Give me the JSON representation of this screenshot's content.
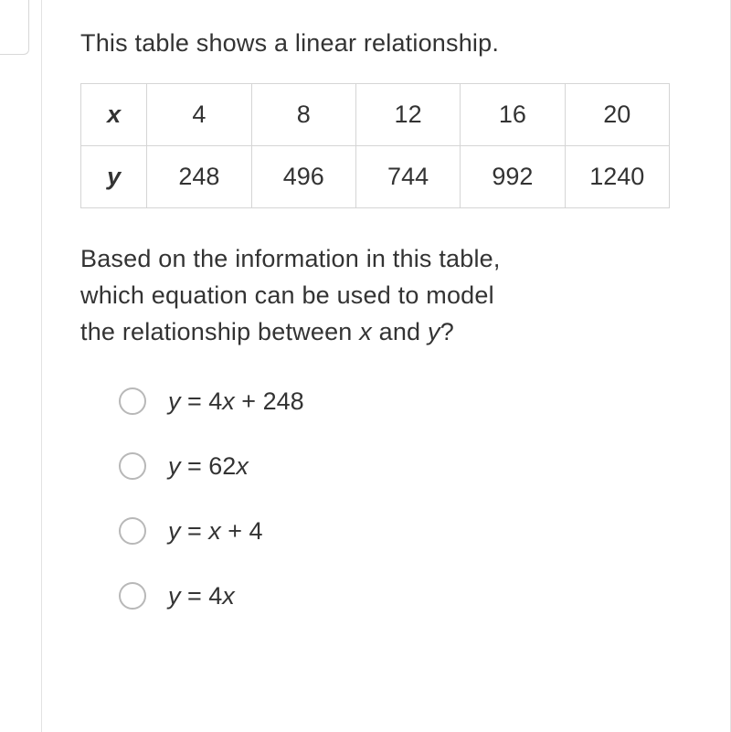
{
  "intro": "This table shows a linear relationship.",
  "table": {
    "row1_header": "x",
    "row1": [
      "4",
      "8",
      "12",
      "16",
      "20"
    ],
    "row2_header": "y",
    "row2": [
      "248",
      "496",
      "744",
      "992",
      "1240"
    ]
  },
  "question": {
    "line1": "Based on the information in this table,",
    "line2": "which equation can be used to model",
    "line3_a": "the relationship between ",
    "line3_x": "x",
    "line3_b": " and ",
    "line3_y": "y",
    "line3_c": "?"
  },
  "options": {
    "a": {
      "y": "y",
      "rest": " = 4x + 248",
      "plain_rest": " = 4",
      "x": "x",
      "tail": " + 248"
    },
    "b": {
      "y": "y",
      "eq": " = 62",
      "x": "x"
    },
    "c": {
      "y": "y",
      "eq": " = ",
      "x": "x",
      "tail": " + 4"
    },
    "d": {
      "y": "y",
      "eq": " = 4",
      "x": "x"
    }
  }
}
